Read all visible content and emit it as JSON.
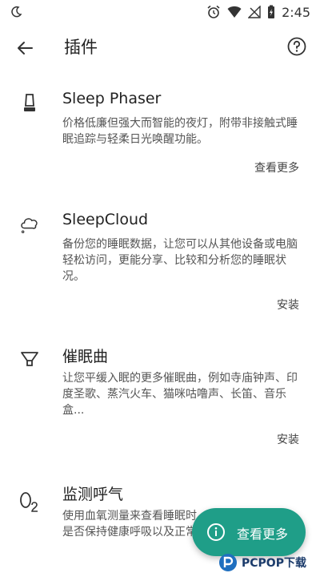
{
  "status_bar": {
    "time": "2:45",
    "icons": [
      "moon-icon",
      "alarm-icon",
      "wifi-icon",
      "no-signal-icon",
      "battery-charging-icon"
    ]
  },
  "app_bar": {
    "title": "插件",
    "back_icon": "arrow-back-icon",
    "help_icon": "help-circle-icon"
  },
  "plugins": [
    {
      "icon": "sleep-phaser-lamp-icon",
      "name": "Sleep Phaser",
      "description": "价格低廉但强大而智能的夜灯，附带非接触式睡眠追踪与轻柔日光唤醒功能。",
      "action": "查看更多"
    },
    {
      "icon": "cloud-icon",
      "name": "SleepCloud",
      "description": "备份您的睡眠数据，让您可以从其他设备或电脑轻松访问，更能分享、比较和分析您的睡眠状况。",
      "action": "安装"
    },
    {
      "icon": "lullaby-bowl-icon",
      "name": "催眠曲",
      "description": "让您平缓入眠的更多催眠曲，例如寺庙钟声、印度圣歌、蒸汽火车、猫咪咕噜声、长笛、音乐盒...",
      "action": "安装"
    },
    {
      "icon": "o2-icon",
      "name": "监测呼气",
      "description": "使用血氧测量来查看睡眠时是否保持健康呼吸以及正常",
      "action": ""
    }
  ],
  "fab": {
    "label": "查看更多",
    "icon": "info-icon"
  },
  "watermark": {
    "text": "PCPOP下载"
  },
  "colors": {
    "accent": "#1f9e88",
    "background": "#ffffff",
    "text_primary": "#222222",
    "text_secondary": "#555555"
  }
}
